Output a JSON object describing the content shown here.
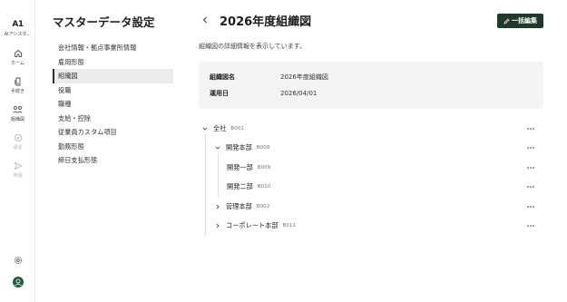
{
  "rail": {
    "logo_mark": "A1",
    "logo_label": "AIアシスタ...",
    "items": [
      {
        "label": "ホーム",
        "icon": "home-icon"
      },
      {
        "label": "手続き",
        "icon": "document-icon"
      },
      {
        "label": "組織図",
        "icon": "org-chart-icon"
      },
      {
        "label": "承認",
        "icon": "check-circle-icon"
      },
      {
        "label": "申請",
        "icon": "send-icon"
      }
    ],
    "settings_icon": "gear-icon",
    "avatar_icon": "avatar"
  },
  "nav": {
    "title": "マスターデータ設定",
    "items": [
      {
        "label": "会社情報・拠点事業所情報"
      },
      {
        "label": "雇用形態"
      },
      {
        "label": "組織図",
        "active": true
      },
      {
        "label": "役職"
      },
      {
        "label": "職種"
      },
      {
        "label": "支給・控除"
      },
      {
        "label": "従業員カスタム項目"
      },
      {
        "label": "勤務形態"
      },
      {
        "label": "締日支払形態"
      }
    ]
  },
  "header": {
    "title": "2026年度組織図",
    "bulk_edit_label": "一括編集"
  },
  "description": "組織図の詳細情報を表示しています。",
  "info": {
    "name_label": "組織図名",
    "name_value": "2026年度組織図",
    "date_label": "運用日",
    "date_value": "2026/04/01"
  },
  "tree": [
    {
      "name": "全社",
      "code": "B001",
      "expanded": true,
      "level": 0
    },
    {
      "name": "開発本部",
      "code": "B008",
      "expanded": true,
      "level": 1
    },
    {
      "name": "開発一部",
      "code": "B009",
      "level": 2
    },
    {
      "name": "開発二部",
      "code": "B010",
      "level": 2
    },
    {
      "name": "管理本部",
      "code": "B002",
      "expanded": false,
      "level": 1
    },
    {
      "name": "コーポレート本部",
      "code": "B011",
      "expanded": false,
      "level": 1
    }
  ],
  "colors": {
    "accent": "#1f3a2c",
    "active_bg": "#ececec",
    "card_bg": "#f4f4f4"
  }
}
